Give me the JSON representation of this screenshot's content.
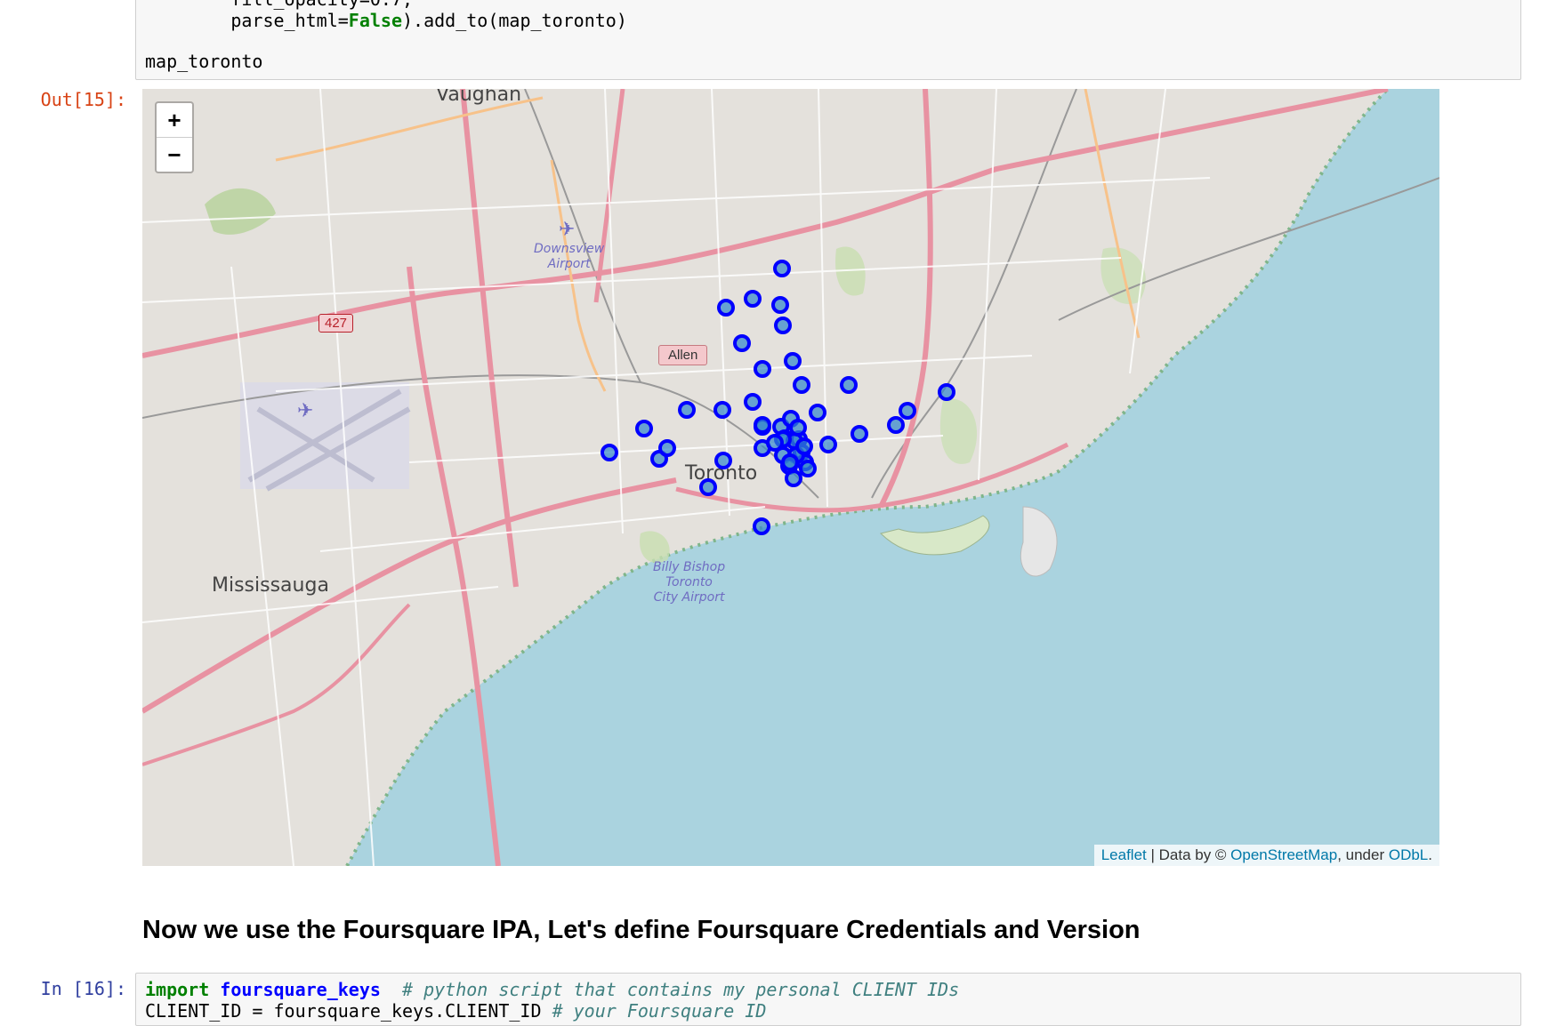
{
  "top_cell": {
    "line1_prefix": "        fill_opacity=0.7,",
    "line2_prefix": "        parse_html=",
    "line2_kw": "False",
    "line2_suffix": ").add_to(map_toronto)",
    "line3": "map_toronto"
  },
  "output_prompt": "Out[15]:",
  "map": {
    "zoom_in": "+",
    "zoom_out": "−",
    "attribution": {
      "leaflet": "Leaflet",
      "data_by": " | Data by © ",
      "osm": "OpenStreetMap",
      "under": ", under ",
      "odbl": "ODbL",
      "period": "."
    },
    "labels": {
      "vaughan": "Vaughan",
      "mississauga": "Mississauga",
      "toronto": "Toronto",
      "downsview_line1": "Downsview",
      "downsview_line2": "Airport",
      "billy_line1": "Billy Bishop",
      "billy_line2": "Toronto",
      "billy_line3": "City Airport",
      "hwy_427": "427",
      "allen": "Allen"
    },
    "marker_color": "#0000ff",
    "marker_fill": "#3186cc",
    "marker_count": 46
  },
  "markdown_heading": "Now we use the Foursquare IPA, Let's define Foursquare Credentials and Version",
  "input_prompt": "In [16]:",
  "bottom_cell": {
    "l1_kw": "import",
    "l1_mod": "foursquare_keys",
    "l1_comment": "  # python script that contains my personal CLIENT IDs",
    "l2_code": "CLIENT_ID = foursquare_keys.CLIENT_ID ",
    "l2_comment": "# your Foursquare ID"
  }
}
